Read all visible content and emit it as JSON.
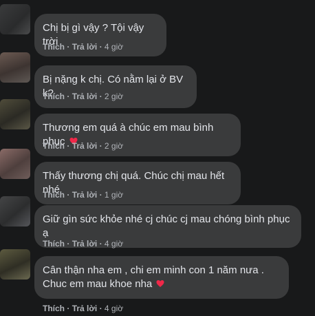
{
  "actions": {
    "like": "Thích",
    "reply": "Trả lời",
    "sep": "·"
  },
  "accent": {
    "heart": "#f02849",
    "bubble": "#3a3b3c",
    "bg": "#18191a",
    "meta": "#b0b3b8"
  },
  "comments": [
    {
      "text": "Chị bị gì vậy ? Tội vậy trời",
      "time": "4 giờ"
    },
    {
      "text": "Bị nặng k chị. Có nằm lại ở BV k?",
      "time": "2 giờ"
    },
    {
      "text": "Thương em quá à chúc em mau bình phục",
      "time": "2 giờ",
      "emoji": "heart-icon"
    },
    {
      "text": "Thấy thương chị quá. Chúc chị mau hết nhé",
      "time": "1 giờ"
    },
    {
      "text": "Giữ gìn sức khỏe nhé cj chúc cj mau chóng bình phục ạ",
      "time": "4 giờ"
    },
    {
      "text": "Cân thận nha em , chi em minh con 1 năm nưa . Chuc em mau khoe nha",
      "time": "4 giờ",
      "emoji": "heart-icon"
    }
  ]
}
